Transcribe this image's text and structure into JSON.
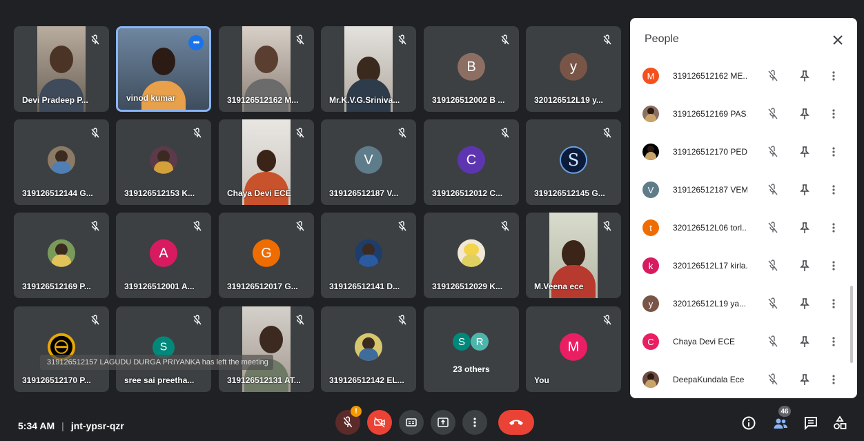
{
  "tiles": [
    {
      "name": "Devi Pradeep P..."
    },
    {
      "name": "vinod kumar"
    },
    {
      "name": "319126512162 M..."
    },
    {
      "name": "Mr.K.V.G.Sriniva..."
    },
    {
      "name": "319126512002 B ...",
      "initial": "B"
    },
    {
      "name": "320126512L19 y...",
      "initial": "y"
    },
    {
      "name": "319126512144 G..."
    },
    {
      "name": "319126512153 K..."
    },
    {
      "name": "Chaya Devi ECE"
    },
    {
      "name": "319126512187 V...",
      "initial": "V"
    },
    {
      "name": "319126512012 C...",
      "initial": "C"
    },
    {
      "name": "319126512145 G...",
      "initial": "S"
    },
    {
      "name": "319126512169 P..."
    },
    {
      "name": "319126512001 A...",
      "initial": "A"
    },
    {
      "name": "319126512017 G...",
      "initial": "G"
    },
    {
      "name": "319126512141 D..."
    },
    {
      "name": "319126512029 K..."
    },
    {
      "name": "M.Veena ece"
    },
    {
      "name": "319126512170 P..."
    },
    {
      "name": "sree sai preetha...",
      "initial": "S"
    },
    {
      "name": "319126512131 AT..."
    },
    {
      "name": "319126512142 EL..."
    },
    {
      "others_label": "23 others",
      "initials": [
        "S",
        "R"
      ]
    },
    {
      "name": "You",
      "initial": "M"
    }
  ],
  "toast": "319126512157 LAGUDU DURGA PRIYANKA has left the meeting",
  "colors": {
    "background": "#202124",
    "tile": "#3c4043",
    "accent": "#1a73e8",
    "danger": "#ea4335",
    "avatar_B": "#8d6e63",
    "avatar_y": "#795548",
    "avatar_V": "#5f7c8a",
    "avatar_C": "#5e35b1",
    "avatar_A": "#d81b60",
    "avatar_G": "#ef6c00",
    "avatar_S": "#00897b",
    "avatar_M": "#e91e63"
  },
  "people_panel": {
    "title": "People",
    "close_icon": "close-icon",
    "rows": [
      {
        "name": "319126512162 ME...",
        "initial": "M",
        "color": "#f4511e"
      },
      {
        "name": "319126512169 PAS...",
        "initial": "",
        "color": "#8d6e63"
      },
      {
        "name": "319126512170 PED...",
        "initial": "",
        "color": "#000000"
      },
      {
        "name": "319126512187 VEM...",
        "initial": "V",
        "color": "#5f7c8a"
      },
      {
        "name": "320126512L06 torl...",
        "initial": "t",
        "color": "#ef6c00"
      },
      {
        "name": "320126512L17 kirla...",
        "initial": "k",
        "color": "#d81b60"
      },
      {
        "name": "320126512L19 ya...",
        "initial": "y",
        "color": "#795548"
      },
      {
        "name": "Chaya Devi ECE",
        "initial": "C",
        "color": "#e91e63"
      },
      {
        "name": "DeepaKundala Ece",
        "initial": "",
        "color": "#6d4c41"
      }
    ],
    "row_icons": [
      "mic-off-icon",
      "pin-icon",
      "more-vert-icon"
    ]
  },
  "bottom_bar": {
    "time": "5:34 AM",
    "separator": "|",
    "meeting_code": "jnt-ypsr-qzr",
    "controls": [
      "mic-off-icon",
      "camera-off-icon",
      "captions-icon",
      "present-icon",
      "more-options-icon",
      "end-call-icon"
    ],
    "people_count": "46",
    "mic_warning": "!"
  }
}
